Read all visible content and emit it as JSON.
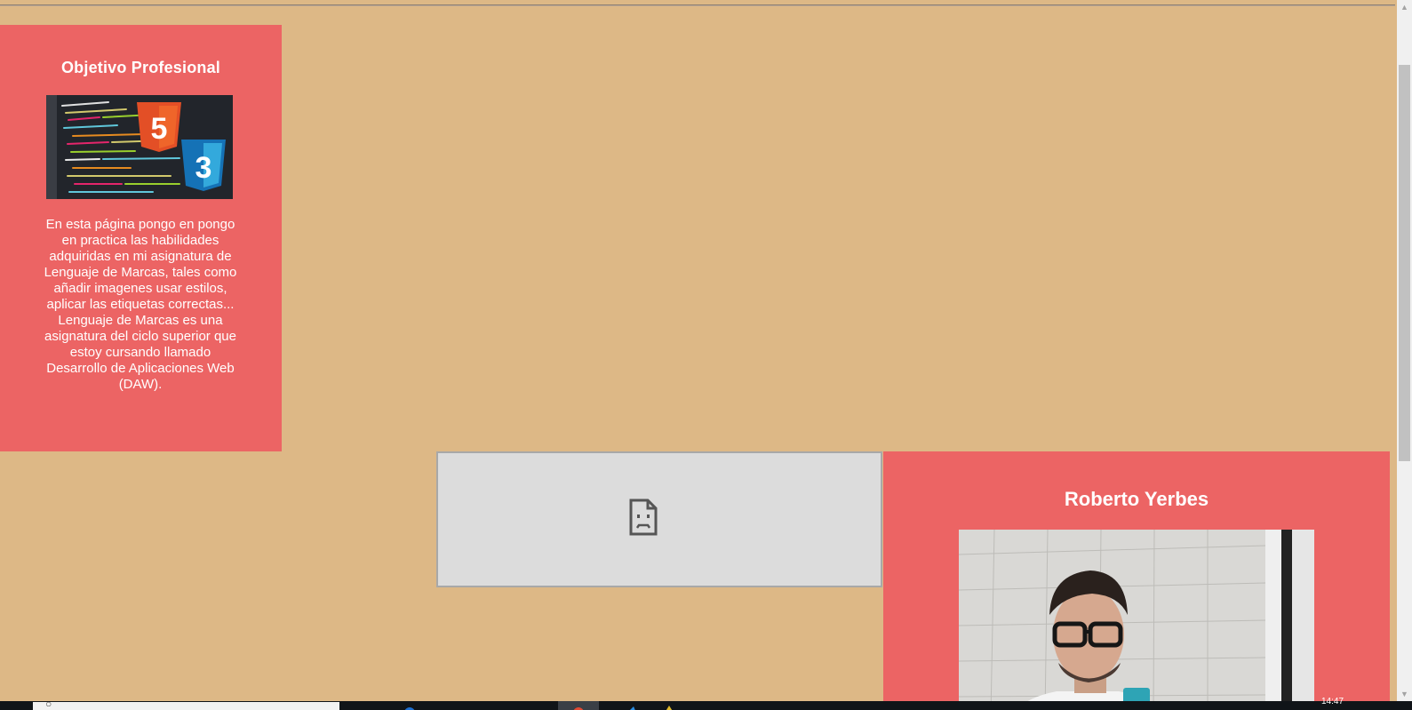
{
  "objective": {
    "title": "Objetivo Profesional",
    "image_alt": "HTML5 y CSS3",
    "image_badges": [
      "5",
      "3"
    ],
    "text": "En esta página pongo en pongo en practica las habilidades adquiridas en mi asignatura de Lenguaje de Marcas, tales como añadir imagenes usar estilos, aplicar las etiquetas correctas... Lenguaje de Marcas es una asignatura del ciclo superior que estoy cursando llamado Desarrollo de Aplicaciones Web (DAW)."
  },
  "embed": {
    "state": "broken",
    "icon": "sad-document-icon"
  },
  "profile": {
    "name": "Roberto Yerbes",
    "photo_alt": "Roberto Yerbes"
  },
  "taskbar": {
    "search_glyph": "○",
    "clock": "14:47"
  },
  "colors": {
    "background": "#ddb886",
    "card": "#ec6464",
    "html5_orange": "#e34f26",
    "css3_blue": "#1572b6"
  }
}
